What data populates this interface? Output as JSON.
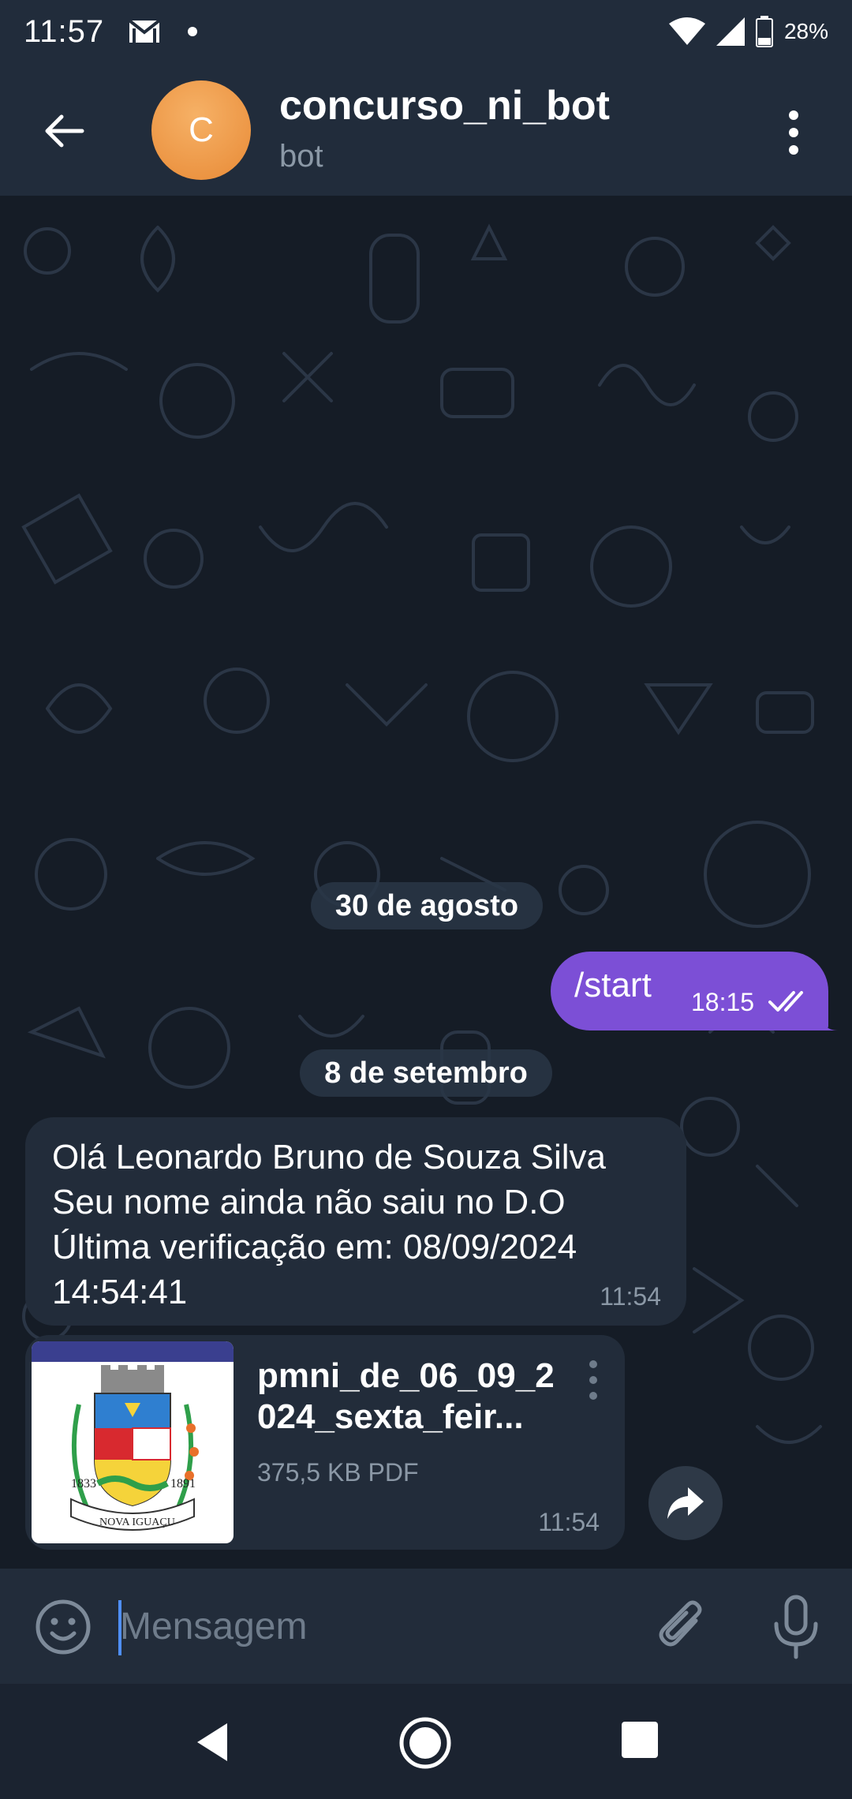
{
  "status_bar": {
    "time": "11:57",
    "battery": "28%"
  },
  "header": {
    "avatar_letter": "C",
    "title": "concurso_ni_bot",
    "subtitle": "bot"
  },
  "messages": {
    "date1": "30 de agosto",
    "outgoing": {
      "text": "/start",
      "time": "18:15"
    },
    "date2": "8 de setembro",
    "incoming": {
      "lines": [
        "Olá Leonardo Bruno de Souza Silva",
        "Seu nome ainda não saiu no D.O",
        "Última verificação em: 08/09/2024",
        "14:54:41"
      ],
      "time": "11:54"
    },
    "file": {
      "name_line1": "pmni_de_06_09_2",
      "name_line2": "024_sexta_feir...",
      "meta": "375,5 KB PDF",
      "time": "11:54",
      "thumb_year_left": "1833",
      "thumb_year_right": "1891",
      "thumb_city": "NOVA IGUAÇU"
    }
  },
  "input": {
    "placeholder": "Mensagem"
  },
  "colors": {
    "accent": "#7c4fd6",
    "header_bg": "#212c3b",
    "chat_bg": "#151c26",
    "bubble_in": "#222c3a",
    "cursor": "#4f8ff7"
  },
  "icons": [
    "mail-icon",
    "dot-icon",
    "wifi-icon",
    "signal-icon",
    "battery-icon",
    "back-arrow-icon",
    "more-vert-icon",
    "double-check-icon",
    "file-menu-icon",
    "share-icon",
    "emoji-icon",
    "attach-icon",
    "mic-icon",
    "nav-back-icon",
    "nav-home-icon",
    "nav-recent-icon"
  ]
}
